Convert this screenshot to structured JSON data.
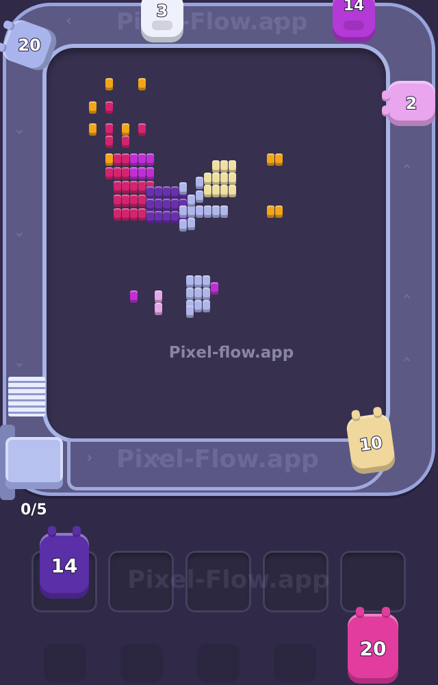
{
  "watermarks": {
    "center": "Pixel-flow.app",
    "belt_top": "Pixel-Flow.app",
    "belt_bottom": "Pixel-Flow.app",
    "slots": "Pixel-Flow.app"
  },
  "belt_pigs": [
    {
      "name": "belt-pig-topleft",
      "count": "20",
      "color": "#a9b4ec"
    },
    {
      "name": "belt-pig-top-white",
      "count": "3",
      "color": "#eef0fb"
    },
    {
      "name": "belt-pig-top-purple",
      "count": "14",
      "color": "#b43ad8"
    },
    {
      "name": "belt-pig-right-pink",
      "count": "2",
      "color": "#e9a5ee"
    },
    {
      "name": "belt-pig-bottomright-gold",
      "count": "10",
      "color": "#f0d79b"
    }
  ],
  "queue": {
    "counter": "0/5",
    "slot_pig": {
      "count": "14",
      "color": "#5a2fa8"
    },
    "waiting_pig": {
      "count": "20",
      "color": "#e23c9f"
    }
  },
  "colors": {
    "gold": "#f2a516",
    "magenta": "#d4246f",
    "purple": "#6a2fb0",
    "violet": "#c02fd6",
    "lavender": "#aeb6ea",
    "cream": "#efe0a2",
    "lightpink": "#e6a8e8"
  }
}
